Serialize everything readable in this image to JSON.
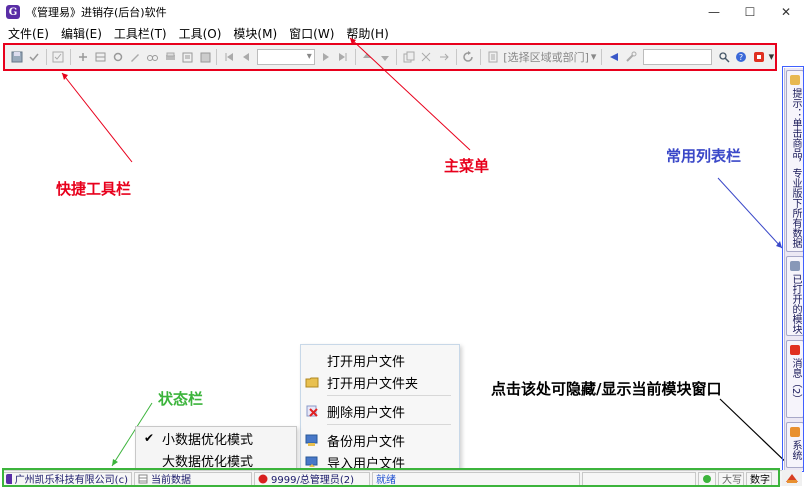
{
  "window": {
    "title": "《管理易》进销存(后台)软件",
    "minimize": "—",
    "maximize": "☐",
    "close": "✕"
  },
  "menubar": {
    "items": [
      "文件(E)",
      "编辑(E)",
      "工具栏(T)",
      "工具(O)",
      "模块(M)",
      "窗口(W)",
      "帮助(H)"
    ]
  },
  "toolbar": {
    "region_placeholder": "[选择区域或部门]",
    "dropdown_arrow": "▾"
  },
  "annotations": {
    "quick_toolbar": "快捷工具栏",
    "main_menu": "主菜单",
    "common_list": "常用列表栏",
    "status_bar": "状态栏",
    "toggle_hint": "点击该处可隐藏/显示当前模块窗口"
  },
  "sidebar": {
    "tabs": [
      {
        "label": "提示：单击商品，专业版下所有数据"
      },
      {
        "label": "已打开的模块"
      },
      {
        "label": "消息（2）"
      },
      {
        "label": "系统"
      }
    ]
  },
  "context_menu": {
    "items": [
      {
        "label": "打开用户文件",
        "icon": "none"
      },
      {
        "label": "打开用户文件夹",
        "icon": "folder-icon"
      },
      {
        "label": "删除用户文件",
        "icon": "delete-icon"
      },
      {
        "label": "备份用户文件",
        "icon": "backup-icon"
      },
      {
        "label": "导入用户文件",
        "icon": "import-icon"
      }
    ]
  },
  "submenu": {
    "items": [
      {
        "label": "小数据优化模式",
        "checked": "✔"
      },
      {
        "label": "大数据优化模式",
        "checked": ""
      }
    ]
  },
  "statusbar": {
    "company": "广州凯乐科技有限公司(c)",
    "db": "当前数据",
    "user": "9999/总管理员(2)",
    "state": "就绪",
    "caps": "大写",
    "num": "数字"
  },
  "colors": {
    "annotation_red": "#e8001c",
    "annotation_blue": "#3a48c8",
    "annotation_green": "#3cb43c"
  }
}
